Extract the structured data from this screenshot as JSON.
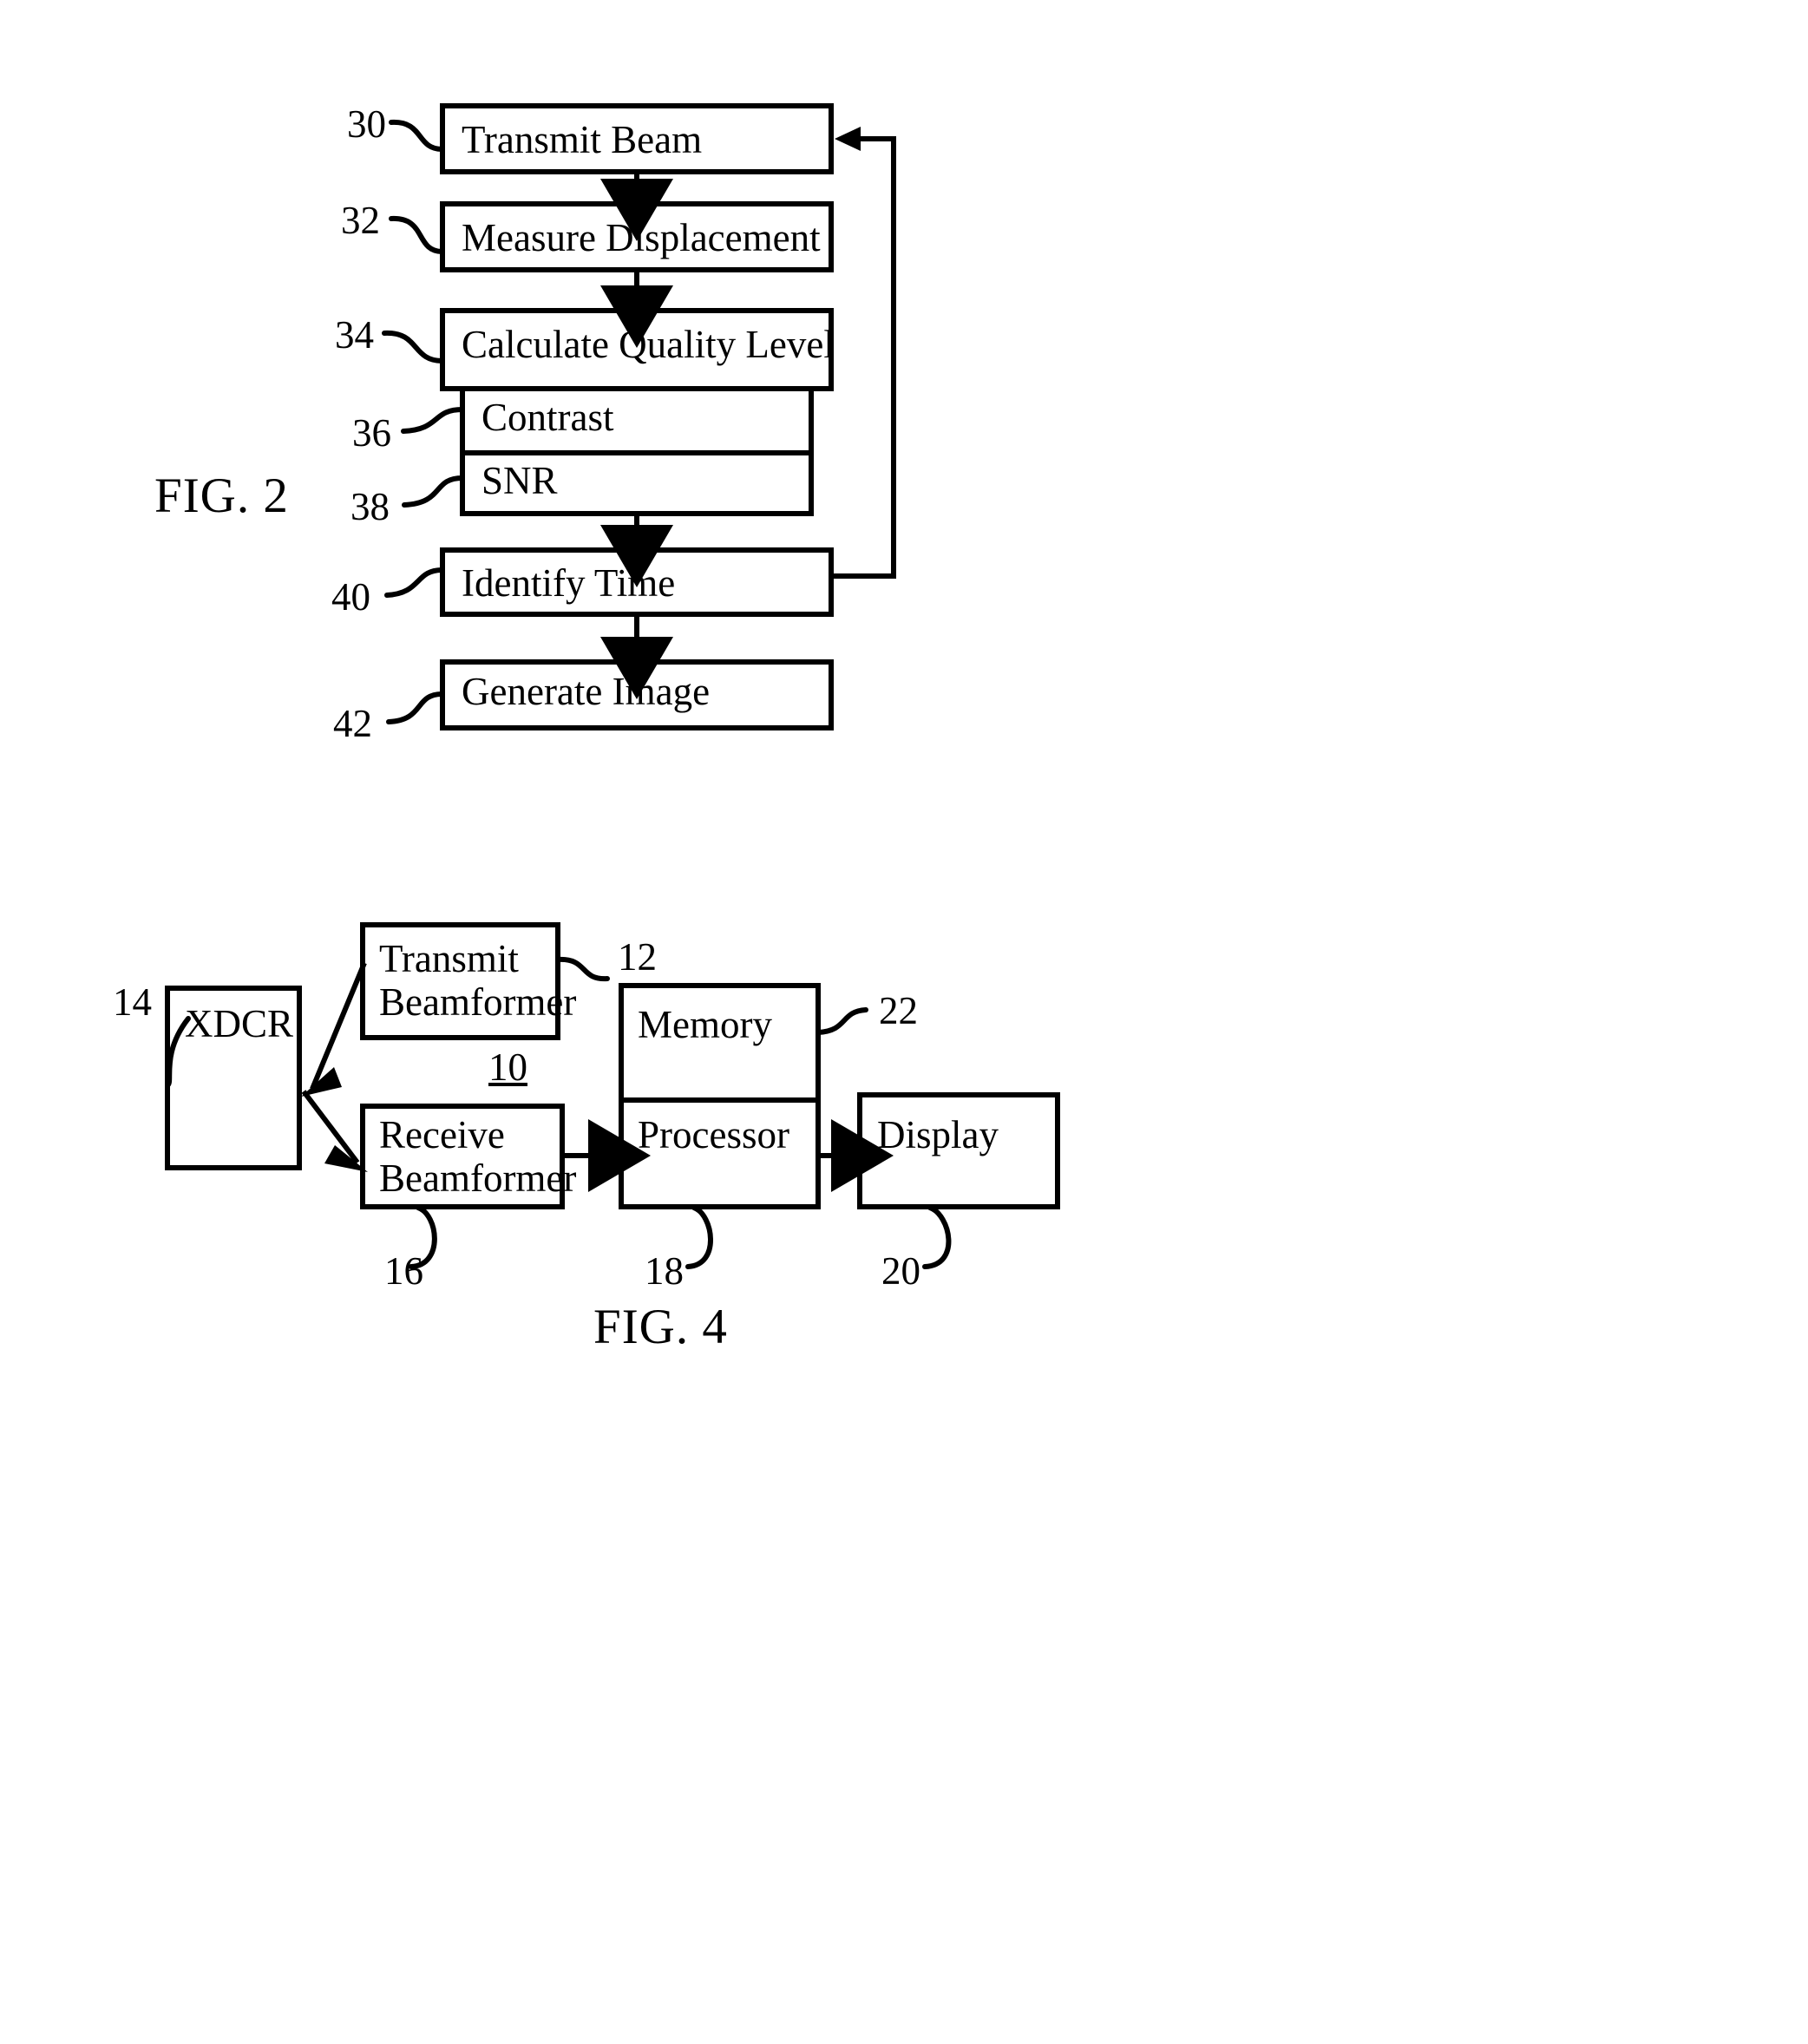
{
  "figures": [
    {
      "id": "fig2",
      "title": "FIG. 2",
      "type": "flowchart",
      "steps": [
        {
          "ref": "30",
          "label": "Transmit Beam"
        },
        {
          "ref": "32",
          "label": "Measure Displacement"
        },
        {
          "ref": "34",
          "label": "Calculate Quality Level"
        },
        {
          "ref": "36",
          "label": "Contrast"
        },
        {
          "ref": "38",
          "label": "SNR"
        },
        {
          "ref": "40",
          "label": "Identify Time"
        },
        {
          "ref": "42",
          "label": "Generate Image"
        }
      ],
      "flow": [
        "Transmit Beam -> Measure Displacement",
        "Measure Displacement -> Calculate Quality Level",
        "Calculate Quality Level -> Identify Time",
        "Identify Time -> Generate Image",
        "Identify Time -> Transmit Beam (feedback loop)"
      ]
    },
    {
      "id": "fig4",
      "title": "FIG. 4",
      "type": "block-diagram",
      "system_ref": "10",
      "blocks": [
        {
          "ref": "14",
          "label": "XDCR"
        },
        {
          "ref": "12",
          "label_line1": "Transmit",
          "label_line2": "Beamformer"
        },
        {
          "ref": "16",
          "label_line1": "Receive",
          "label_line2": "Beamformer"
        },
        {
          "ref": "22",
          "label": "Memory"
        },
        {
          "ref": "18",
          "label": "Processor"
        },
        {
          "ref": "20",
          "label": "Display"
        }
      ],
      "connections": [
        "Transmit Beamformer -> XDCR",
        "XDCR -> Receive Beamformer",
        "Receive Beamformer -> Processor",
        "Processor -> Display"
      ]
    }
  ],
  "colors": {
    "ink": "#000000",
    "paper": "#ffffff"
  }
}
